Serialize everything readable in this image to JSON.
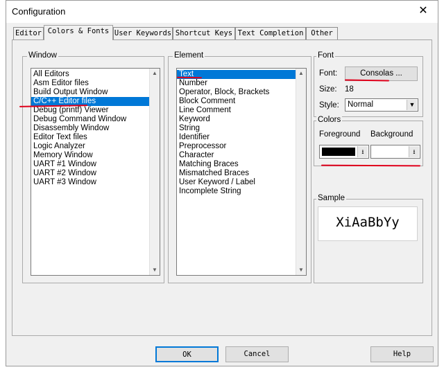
{
  "window": {
    "title": "Configuration",
    "close_glyph": "✕"
  },
  "tabs": [
    {
      "label": "Editor",
      "active": false
    },
    {
      "label": "Colors & Fonts",
      "active": true
    },
    {
      "label": "User Keywords",
      "active": false
    },
    {
      "label": "Shortcut Keys",
      "active": false
    },
    {
      "label": "Text Completion",
      "active": false
    },
    {
      "label": "Other",
      "active": false
    }
  ],
  "window_group": {
    "label": "Window",
    "items": [
      "All Editors",
      "Asm Editor files",
      "Build Output Window",
      "C/C++ Editor files",
      "Debug (printf) Viewer",
      "Debug Command Window",
      "Disassembly Window",
      "Editor Text files",
      "Logic Analyzer",
      "Memory Window",
      "UART #1 Window",
      "UART #2 Window",
      "UART #3 Window"
    ],
    "selected_index": 3
  },
  "element_group": {
    "label": "Element",
    "items": [
      "Text",
      "Number",
      "Operator, Block, Brackets",
      "Block Comment",
      "Line Comment",
      "Keyword",
      "String",
      "Identifier",
      "Preprocessor",
      "Character",
      "Matching Braces",
      "Mismatched Braces",
      "User Keyword / Label",
      "Incomplete String"
    ],
    "selected_index": 0
  },
  "font_group": {
    "label": "Font",
    "font_label": "Font:",
    "font_button": "Consolas ...",
    "size_label": "Size:",
    "size_value": "18",
    "style_label": "Style:",
    "style_value": "Normal"
  },
  "colors_group": {
    "label": "Colors",
    "foreground_label": "Foreground",
    "background_label": "Background",
    "foreground_color": "#000000",
    "background_color": "#ffffff"
  },
  "sample_group": {
    "label": "Sample",
    "sample_text": "XiAaBbYy"
  },
  "buttons": {
    "ok": "OK",
    "cancel": "Cancel",
    "help": "Help"
  },
  "annotation_color": "#e0001b"
}
